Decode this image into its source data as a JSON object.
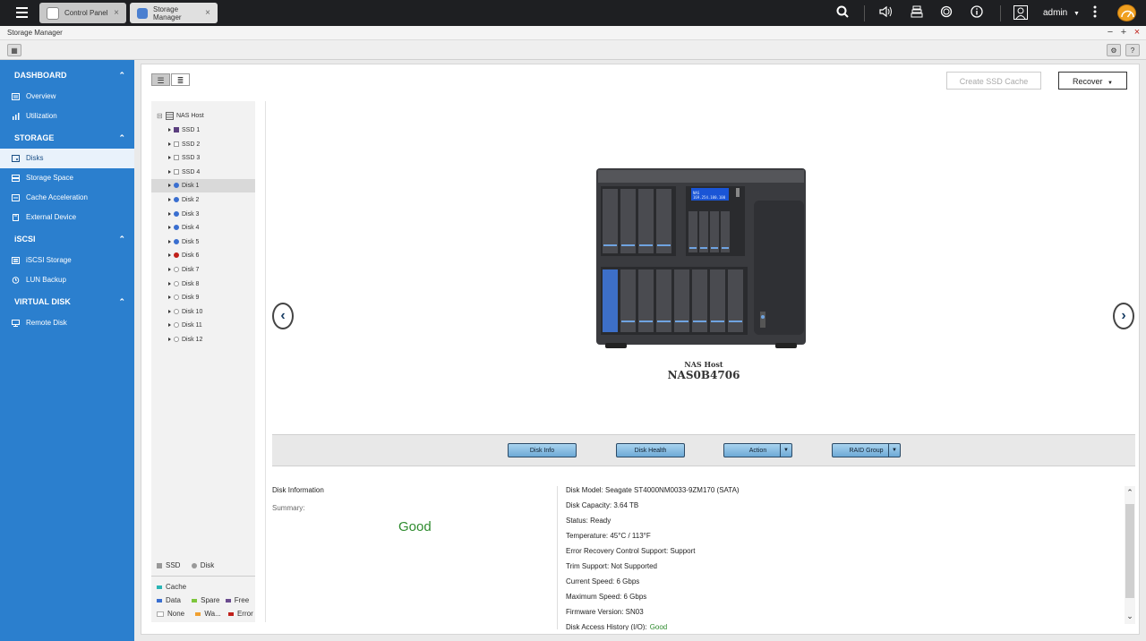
{
  "topbar": {
    "tabs": [
      {
        "label": "Control Panel",
        "close": "×"
      },
      {
        "label": "Storage Manager",
        "close": "×"
      }
    ],
    "user": "admin",
    "menu_icon": "hamburger-icon"
  },
  "window": {
    "title": "Storage Manager",
    "controls": [
      "−",
      "+",
      "×"
    ]
  },
  "sidebar": {
    "sections": [
      {
        "label": "DASHBOARD",
        "items": [
          "Overview",
          "Utilization"
        ]
      },
      {
        "label": "STORAGE",
        "items": [
          "Disks",
          "Storage Space",
          "Cache Acceleration",
          "External Device"
        ]
      },
      {
        "label": "iSCSI",
        "items": [
          "iSCSI Storage",
          "LUN Backup"
        ]
      },
      {
        "label": "VIRTUAL DISK",
        "items": [
          "Remote Disk"
        ]
      }
    ],
    "active_item": "Disks"
  },
  "header_buttons": {
    "create_ssd_cache": "Create SSD Cache",
    "recover": "Recover"
  },
  "tree": {
    "root": "NAS Host",
    "nodes": [
      {
        "label": "SSD 1",
        "kind": "ssd",
        "status": "data"
      },
      {
        "label": "SSD 2",
        "kind": "ssd",
        "status": "none"
      },
      {
        "label": "SSD 3",
        "kind": "ssd",
        "status": "none"
      },
      {
        "label": "SSD 4",
        "kind": "ssd",
        "status": "none"
      },
      {
        "label": "Disk 1",
        "kind": "disk",
        "status": "data",
        "selected": true
      },
      {
        "label": "Disk 2",
        "kind": "disk",
        "status": "data"
      },
      {
        "label": "Disk 3",
        "kind": "disk",
        "status": "data"
      },
      {
        "label": "Disk 4",
        "kind": "disk",
        "status": "data"
      },
      {
        "label": "Disk 5",
        "kind": "disk",
        "status": "data"
      },
      {
        "label": "Disk 6",
        "kind": "disk",
        "status": "error"
      },
      {
        "label": "Disk 7",
        "kind": "disk",
        "status": "none"
      },
      {
        "label": "Disk 8",
        "kind": "disk",
        "status": "none"
      },
      {
        "label": "Disk 9",
        "kind": "disk",
        "status": "none"
      },
      {
        "label": "Disk 10",
        "kind": "disk",
        "status": "none"
      },
      {
        "label": "Disk 11",
        "kind": "disk",
        "status": "none"
      },
      {
        "label": "Disk 12",
        "kind": "disk",
        "status": "none"
      }
    ]
  },
  "legend": {
    "types": [
      "SSD",
      "Disk"
    ],
    "statuses": [
      {
        "label": "Cache",
        "color": "#2ab5b5"
      },
      {
        "label": "Data",
        "color": "#3a6fd0"
      },
      {
        "label": "Spare",
        "color": "#7dc63c"
      },
      {
        "label": "Free",
        "color": "#6b4c8f"
      },
      {
        "label": "None",
        "color": "#ffffff"
      },
      {
        "label": "Wa...",
        "color": "#f0a030"
      },
      {
        "label": "Error",
        "color": "#c0201a"
      }
    ]
  },
  "device": {
    "caption": "NAS Host",
    "name": "NAS0B4706",
    "lcd_line1": "NAS",
    "lcd_line2": "169.254.100.100"
  },
  "actions": {
    "disk_info": "Disk Info",
    "disk_health": "Disk Health",
    "action": "Action",
    "raid_group": "RAID Group"
  },
  "disk_information": {
    "heading": "Disk Information",
    "summary_label": "Summary:",
    "summary_value": "Good",
    "details": [
      "Disk Model: Seagate ST4000NM0033-9ZM170 (SATA)",
      "Disk Capacity: 3.64 TB",
      "Status: Ready",
      "Temperature: 45°C / 113°F",
      "Error Recovery Control Support: Support",
      "Trim Support: Not Supported",
      "Current Speed: 6 Gbps",
      "Maximum Speed: 6 Gbps",
      "Firmware Version: SN03"
    ],
    "access_history_label": "Disk Access History (I/O):",
    "access_history_value": "Good"
  },
  "colors": {
    "sidebar": "#2b7fce",
    "good": "#2e8b2e",
    "disk_data": "#3a6fd0",
    "disk_error": "#c0201a",
    "ssd_data": "#5b3f7f"
  }
}
